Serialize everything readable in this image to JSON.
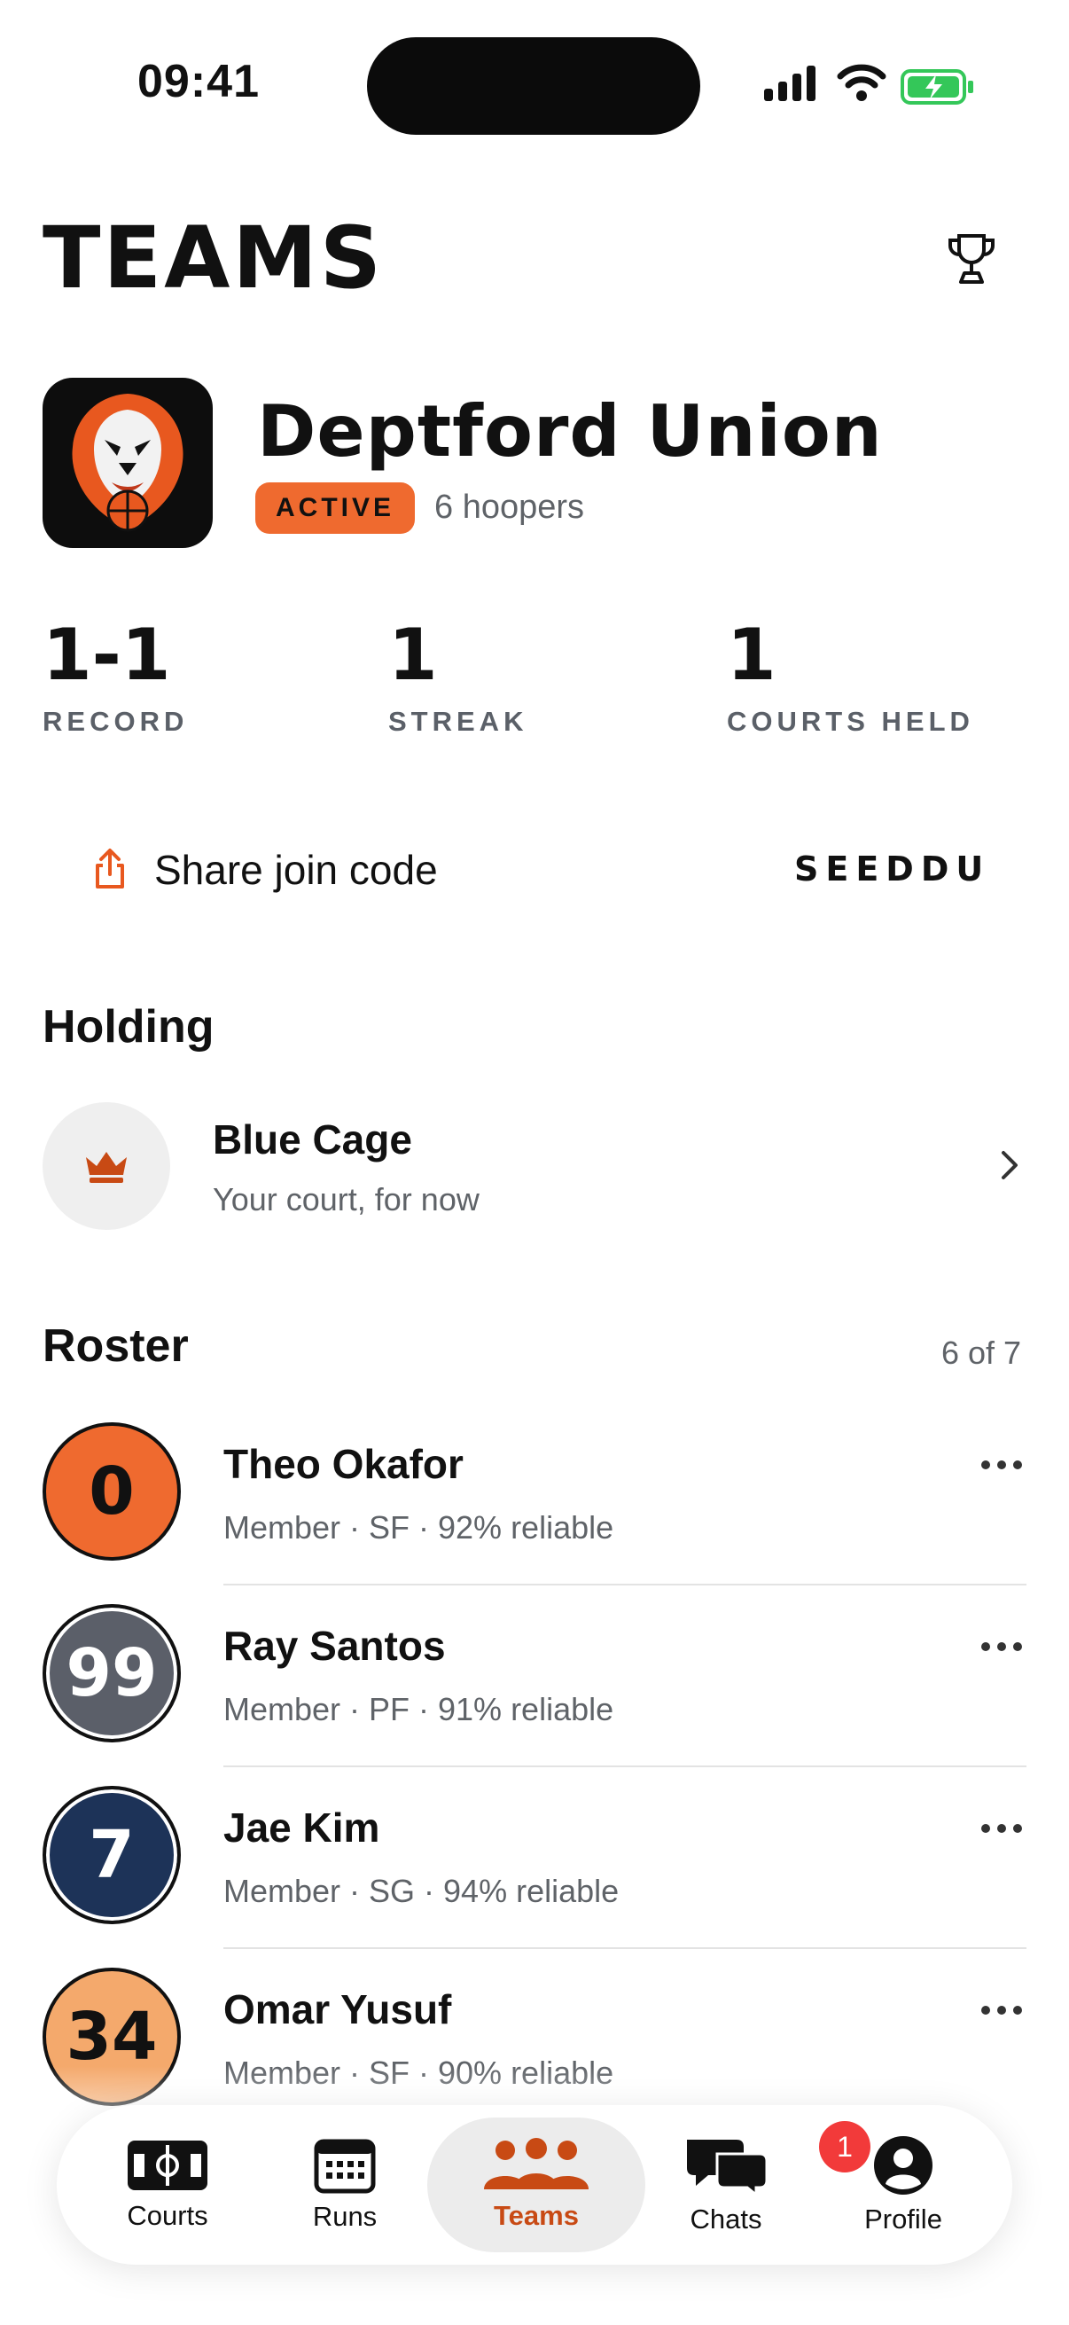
{
  "status_bar": {
    "time": "09:41"
  },
  "header": {
    "title": "TEAMS"
  },
  "team": {
    "name": "Deptford Union",
    "status_badge": "ACTIVE",
    "members_text": "6 hoopers",
    "accent_color": "#ef6a2f"
  },
  "stats": [
    {
      "value": "1-1",
      "label": "RECORD"
    },
    {
      "value": "1",
      "label": "STREAK"
    },
    {
      "value": "1",
      "label": "COURTS HELD"
    }
  ],
  "share": {
    "label": "Share join code",
    "code": "SEEDDU"
  },
  "holding": {
    "title": "Holding",
    "court_name": "Blue Cage",
    "court_sub": "Your court, for now"
  },
  "roster": {
    "title": "Roster",
    "count": "6 of 7",
    "players": [
      {
        "number": "0",
        "name": "Theo Okafor",
        "meta": "Member · SF · 92% reliable",
        "color": "#ef6a2f",
        "text_color": "#111111"
      },
      {
        "number": "99",
        "name": "Ray Santos",
        "meta": "Member · PF · 91% reliable",
        "color": "#5b5f69",
        "text_color": "#ffffff"
      },
      {
        "number": "7",
        "name": "Jae Kim",
        "meta": "Member · SG · 94% reliable",
        "color": "#1d3358",
        "text_color": "#ffffff"
      },
      {
        "number": "34",
        "name": "Omar Yusuf",
        "meta": "Member · SF · 90% reliable",
        "color": "#f4a96c",
        "text_color": "#111111"
      }
    ]
  },
  "tabbar": {
    "tabs": [
      {
        "label": "Courts",
        "icon": "court-icon"
      },
      {
        "label": "Runs",
        "icon": "calendar-icon"
      },
      {
        "label": "Teams",
        "icon": "people-icon",
        "active": true
      },
      {
        "label": "Chats",
        "icon": "chat-icon",
        "badge": "1"
      },
      {
        "label": "Profile",
        "icon": "person-icon"
      }
    ]
  }
}
